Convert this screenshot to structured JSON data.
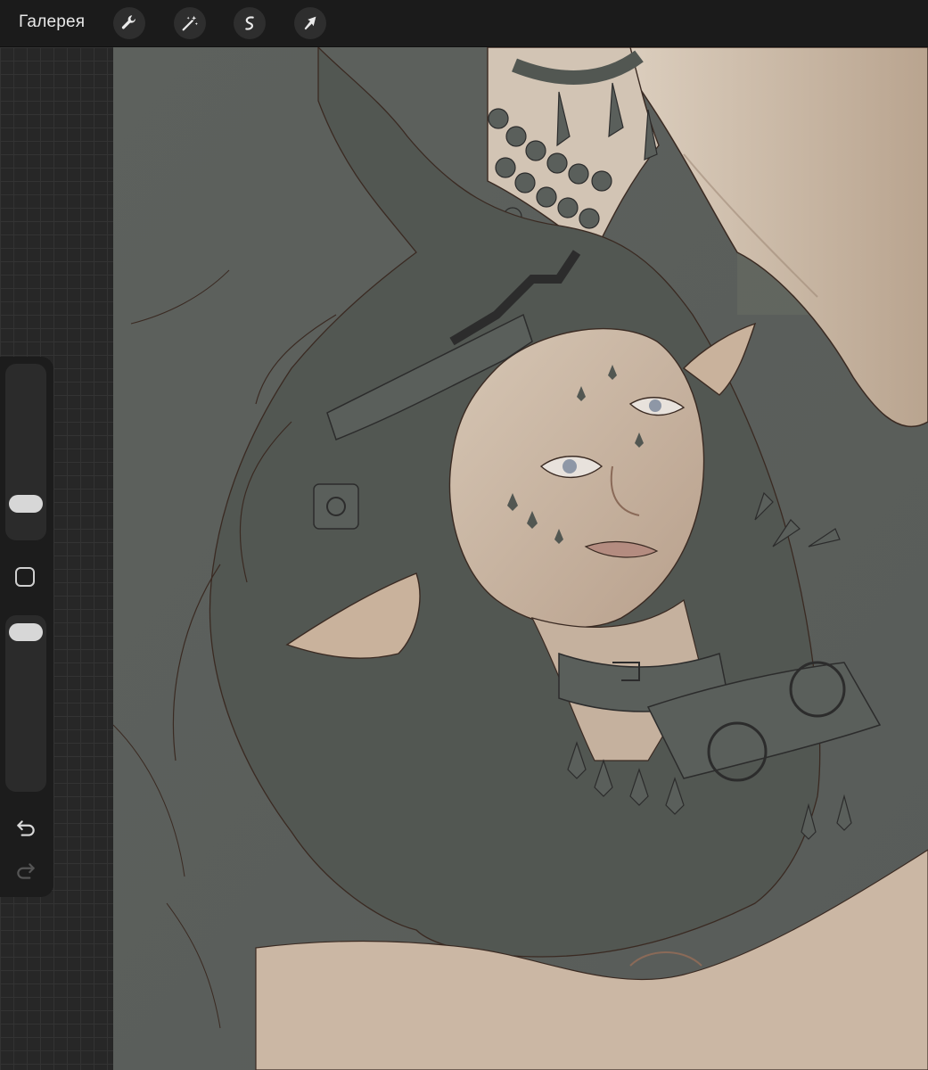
{
  "topbar": {
    "gallery_label": "Галерея",
    "tools": [
      {
        "name": "actions",
        "icon": "wrench-icon"
      },
      {
        "name": "adjustments",
        "icon": "magic-wand-icon"
      },
      {
        "name": "selection",
        "icon": "selection-s-icon"
      },
      {
        "name": "transform",
        "icon": "arrow-cursor-icon"
      }
    ]
  },
  "sidebar": {
    "brush_size_level": 0.16,
    "opacity_level": 0.97,
    "modifier_icon": "square-modifier-icon",
    "undo_icon": "undo-icon",
    "redo_icon": "redo-icon",
    "redo_enabled": false
  },
  "colors": {
    "topbar": "#1b1b1b",
    "canvas_background": "#5a5e5b",
    "skin": "#c8b4a0",
    "hair": "#525752",
    "lineart": "#3a2a22"
  }
}
